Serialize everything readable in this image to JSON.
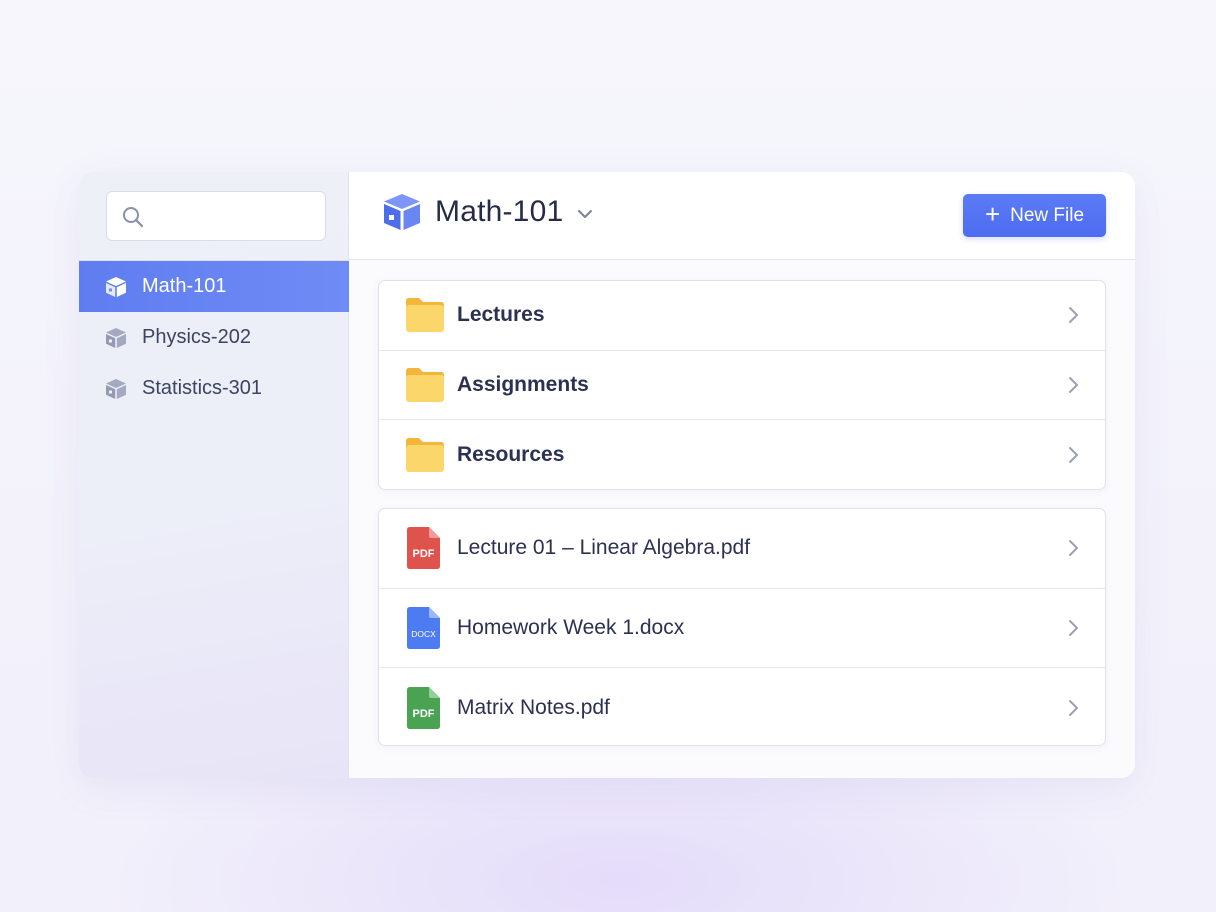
{
  "search": {
    "placeholder": ""
  },
  "sidebar": {
    "items": [
      {
        "label": "Math-101",
        "active": true,
        "icon": "box-icon"
      },
      {
        "label": "Physics-202",
        "active": false,
        "icon": "box-icon"
      },
      {
        "label": "Statistics-301",
        "active": false,
        "icon": "box-icon"
      }
    ]
  },
  "header": {
    "title": "Math-101",
    "new_file_label": "New File"
  },
  "folders": [
    {
      "label": "Lectures",
      "icon": "folder-icon"
    },
    {
      "label": "Assignments",
      "icon": "folder-icon"
    },
    {
      "label": "Resources",
      "icon": "folder-icon"
    }
  ],
  "files": [
    {
      "label": "Lecture 01 – Linear Algebra.pdf",
      "icon": "pdf-file-icon",
      "badge": "PDF",
      "color": "#e0534d"
    },
    {
      "label": "Homework Week 1.docx",
      "icon": "docx-file-icon",
      "badge": "DOCX",
      "color": "#4d7cf2"
    },
    {
      "label": "Matrix Notes.pdf",
      "icon": "pdf-file-icon",
      "badge": "PDF",
      "color": "#4aa253"
    }
  ],
  "colors": {
    "accent": "#5b7bf6",
    "folder": "#f9c84f"
  }
}
